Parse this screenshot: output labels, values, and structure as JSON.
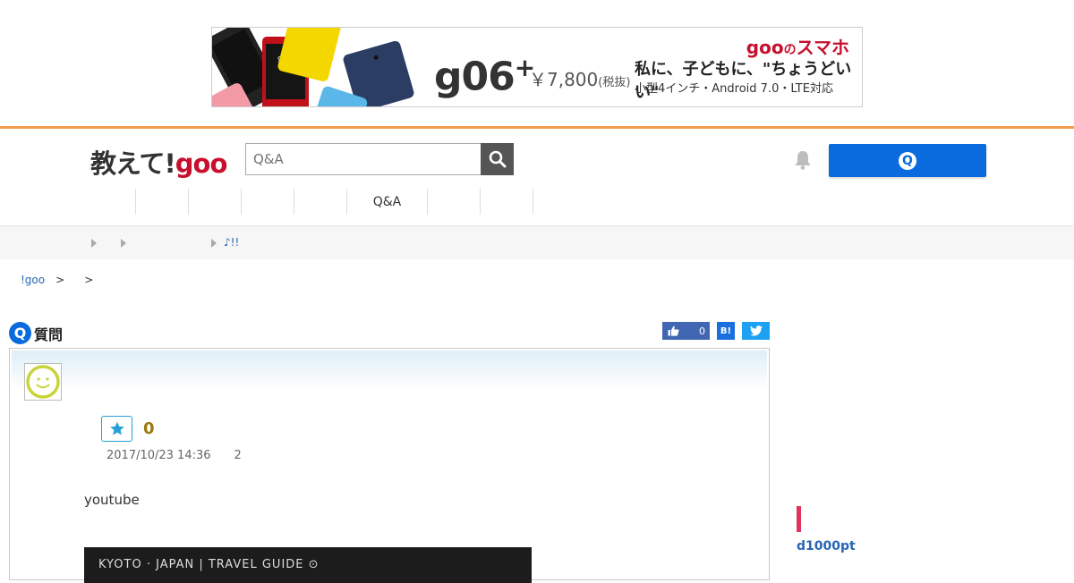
{
  "ad": {
    "brand": "goo",
    "brand_no": "の",
    "brand_suffix": "スマホ",
    "model": "g06",
    "model_sup": "+",
    "price": "￥7,800",
    "price_note": "(税抜)",
    "copy": "私に、子どもに、\"ちょうどいい\"",
    "spec": "小型4インチ・Android 7.0・LTE対応",
    "phone_time": "9:06"
  },
  "header": {
    "logo_prefix": "教えて!",
    "logo_goo": "goo",
    "search_placeholder": "Q&A",
    "ask_icon_text": "Q"
  },
  "nav": {
    "items": [
      {
        "label": ""
      },
      {
        "label": ""
      },
      {
        "label": ""
      },
      {
        "label": ""
      },
      {
        "label": ""
      },
      {
        "label": "Q&A"
      },
      {
        "label": ""
      },
      {
        "label": ""
      }
    ]
  },
  "subbar": {
    "link": "♪!!"
  },
  "breadcrumb": {
    "home": "!goo",
    "sep1": ">",
    "sep2": ">"
  },
  "question": {
    "icon_text": "Q",
    "heading": "質問",
    "fav_count": "0",
    "date": "2017/10/23 14:36",
    "answer_count": "2",
    "body": "youtube",
    "video_title": "KYOTO · JAPAN | TRAVEL GUIDE ⊙"
  },
  "social": {
    "like_count": "0",
    "hatena_label": "B!"
  },
  "sidebar": {
    "label": "d1000pt"
  },
  "colors": {
    "accent_orange": "#f39a4c",
    "brand_red": "#c8102e",
    "primary_blue": "#0a6bde",
    "link_blue": "#2766b5",
    "pink_mark": "#e0345e"
  }
}
